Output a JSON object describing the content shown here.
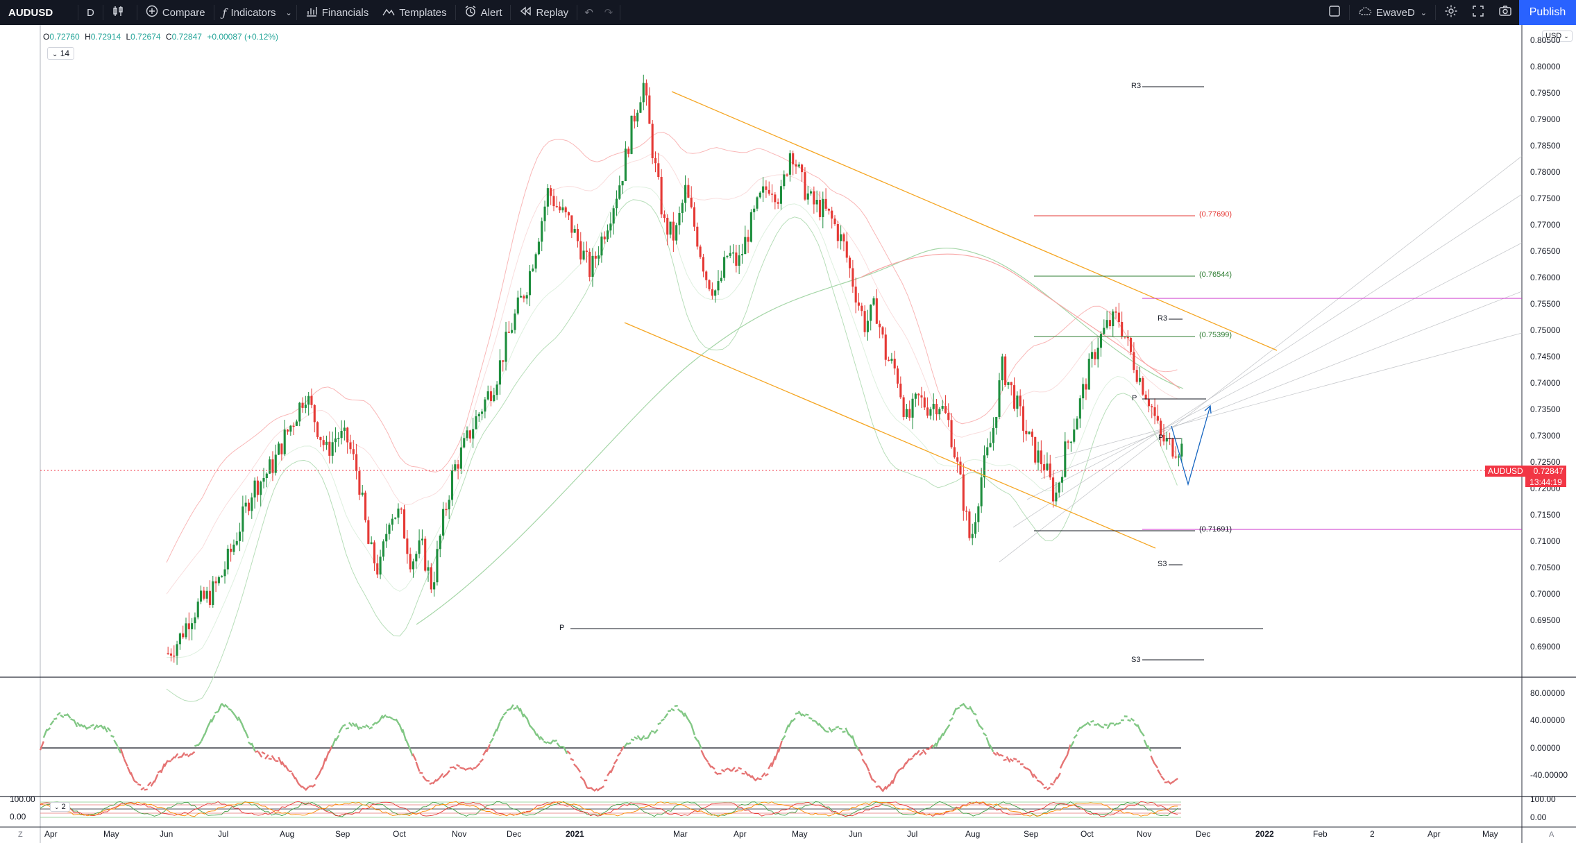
{
  "toolbar": {
    "symbol": "AUDUSD",
    "interval": "D",
    "compare": "Compare",
    "indicators": "Indicators",
    "financials": "Financials",
    "templates": "Templates",
    "alert": "Alert",
    "replay": "Replay",
    "layout_name": "EwaveD",
    "publish": "Publish"
  },
  "legend": {
    "o_label": "O",
    "o": "0.72760",
    "h_label": "H",
    "h": "0.72914",
    "l_label": "L",
    "l": "0.72674",
    "c_label": "C",
    "c": "0.72847",
    "change": "+0.00087 (+0.12%)",
    "indicator_count": "14",
    "lower_indicator_count": "2"
  },
  "currency_select": "USD",
  "price_axis": [
    "0.80500",
    "0.80000",
    "0.79500",
    "0.79000",
    "0.78500",
    "0.78000",
    "0.77500",
    "0.77000",
    "0.76500",
    "0.76000",
    "0.75500",
    "0.75000",
    "0.74500",
    "0.74000",
    "0.73500",
    "0.73000",
    "0.72500",
    "0.72000",
    "0.71500",
    "0.71000",
    "0.70500",
    "0.70000",
    "0.69500",
    "0.69000"
  ],
  "rsi_axis": [
    "80.00000",
    "40.00000",
    "0.00000",
    "-40.00000"
  ],
  "stoch_axis": [
    "100.00",
    "0.00"
  ],
  "lower_left_axis": [
    "100.00",
    "0.00"
  ],
  "time_axis": [
    "Apr",
    "May",
    "Jun",
    "Jul",
    "Aug",
    "Sep",
    "Oct",
    "Nov",
    "Dec",
    "2021",
    "Mar",
    "Apr",
    "May",
    "Jun",
    "Jul",
    "Aug",
    "Sep",
    "Oct",
    "Nov",
    "Dec",
    "2022",
    "Feb",
    "2",
    "Apr",
    "May"
  ],
  "last_price": {
    "symbol": "AUDUSD",
    "price": "0.72847",
    "countdown": "13:44:19"
  },
  "annotations": {
    "fib_1": "(0.77690)",
    "fib_2": "(0.76544)",
    "fib_3": "(0.75399)",
    "fib_4": "(0.71691)",
    "r3_top": "R3",
    "r3_mid": "R3",
    "p_mid": "P",
    "p_small": "P",
    "p_long": "P",
    "s3_mid": "S3",
    "s3_low": "S3"
  },
  "corner_labels": {
    "z": "Z",
    "a": "A"
  },
  "colors": {
    "up": "#26a69a",
    "candle_up": "#1e8e3e",
    "candle_down": "#e53935",
    "channel": "#f5a623",
    "fib_red": "#e53935",
    "fib_green": "#2e7d32",
    "magenta": "#cc33cc",
    "price_tag": "#f23645",
    "arrow": "#1565c0"
  },
  "series": {
    "price_path": [
      [
        0.687,
        0.6905
      ],
      [
        0.6935,
        0.689
      ],
      [
        0.6968,
        0.694
      ],
      [
        0.6995,
        0.697
      ],
      [
        0.7012,
        0.6985
      ],
      [
        0.705,
        0.7012
      ],
      [
        0.7105,
        0.706
      ],
      [
        0.716,
        0.712
      ],
      [
        0.722,
        0.718
      ],
      [
        0.724,
        0.72
      ],
      [
        0.7265,
        0.723
      ],
      [
        0.732,
        0.727
      ],
      [
        0.736,
        0.731
      ],
      [
        0.7405,
        0.736
      ],
      [
        0.735,
        0.73
      ],
      [
        0.729,
        0.725
      ],
      [
        0.7322,
        0.728
      ],
      [
        0.731,
        0.727
      ],
      [
        0.725,
        0.72
      ],
      [
        0.712,
        0.706
      ],
      [
        0.706,
        0.702
      ],
      [
        0.718,
        0.713
      ],
      [
        0.717,
        0.713
      ],
      [
        0.708,
        0.7045
      ],
      [
        0.712,
        0.706
      ],
      [
        0.703,
        0.6995
      ],
      [
        0.715,
        0.712
      ],
      [
        0.7245,
        0.722
      ],
      [
        0.7295,
        0.726
      ],
      [
        0.734,
        0.731
      ],
      [
        0.738,
        0.735
      ],
      [
        0.742,
        0.739
      ],
      [
        0.749,
        0.746
      ],
      [
        0.755,
        0.752
      ],
      [
        0.76,
        0.7575
      ],
      [
        0.77,
        0.765
      ],
      [
        0.779,
        0.774
      ],
      [
        0.775,
        0.771
      ],
      [
        0.772,
        0.769
      ],
      [
        0.768,
        0.764
      ],
      [
        0.763,
        0.759
      ],
      [
        0.769,
        0.765
      ],
      [
        0.774,
        0.772
      ],
      [
        0.782,
        0.777
      ],
      [
        0.792,
        0.787
      ],
      [
        0.801,
        0.793
      ],
      [
        0.785,
        0.78
      ],
      [
        0.772,
        0.768
      ],
      [
        0.77,
        0.765
      ],
      [
        0.778,
        0.775
      ],
      [
        0.771,
        0.766
      ],
      [
        0.762,
        0.758
      ],
      [
        0.759,
        0.755
      ],
      [
        0.766,
        0.763
      ],
      [
        0.764,
        0.761
      ],
      [
        0.77,
        0.768
      ],
      [
        0.776,
        0.773
      ],
      [
        0.779,
        0.777
      ],
      [
        0.776,
        0.774
      ],
      [
        0.787,
        0.783
      ],
      [
        0.78,
        0.776
      ],
      [
        0.776,
        0.772
      ],
      [
        0.774,
        0.772
      ],
      [
        0.772,
        0.769
      ],
      [
        0.768,
        0.764
      ],
      [
        0.76,
        0.756
      ],
      [
        0.753,
        0.749
      ],
      [
        0.756,
        0.753
      ],
      [
        0.747,
        0.743
      ],
      [
        0.744,
        0.74
      ],
      [
        0.734,
        0.731
      ],
      [
        0.739,
        0.735
      ],
      [
        0.737,
        0.734
      ],
      [
        0.738,
        0.735
      ],
      [
        0.734,
        0.73
      ],
      [
        0.724,
        0.719
      ],
      [
        0.711,
        0.708
      ],
      [
        0.725,
        0.719
      ],
      [
        0.731,
        0.728
      ],
      [
        0.744,
        0.742
      ],
      [
        0.74,
        0.736
      ],
      [
        0.734,
        0.73
      ],
      [
        0.729,
        0.725
      ],
      [
        0.727,
        0.722
      ],
      [
        0.717,
        0.719
      ],
      [
        0.729,
        0.726
      ],
      [
        0.735,
        0.732
      ],
      [
        0.743,
        0.739
      ],
      [
        0.749,
        0.746
      ],
      [
        0.752,
        0.75
      ],
      [
        0.754,
        0.751
      ],
      [
        0.748,
        0.745
      ],
      [
        0.742,
        0.74
      ],
      [
        0.738,
        0.735
      ],
      [
        0.731,
        0.728
      ],
      [
        0.729,
        0.727
      ],
      [
        0.7285,
        0.727
      ]
    ]
  }
}
